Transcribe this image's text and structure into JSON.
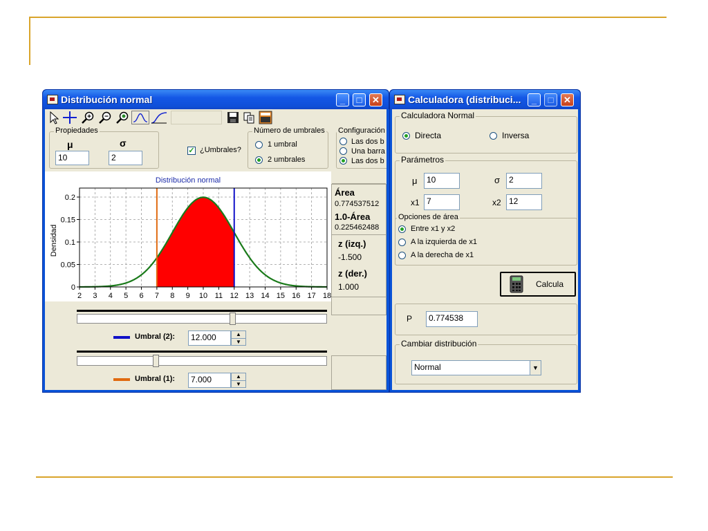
{
  "main_window": {
    "title": "Distribución normal",
    "properties": {
      "group_title": "Propiedades",
      "mu_label": "μ",
      "sigma_label": "σ",
      "mu_value": "10",
      "sigma_value": "2"
    },
    "thresholds_checkbox_label": "¿Umbrales?",
    "num_thresholds": {
      "group_title": "Número de umbrales",
      "option1": "1 umbral",
      "option2": "2 umbrales"
    },
    "configuration": {
      "group_title": "Configuración",
      "option1": "Las dos b",
      "option2": "Una barra",
      "option3": "Las dos b"
    },
    "info": {
      "area_label": "Área",
      "area_value": "0.774537512",
      "complement_label": "1.0-Área",
      "complement_value": "0.225462488",
      "z_left_label": "z (izq.)",
      "z_left_value": "-1.500",
      "z_right_label": "z (der.)",
      "z_right_value": "1.000"
    },
    "threshold2": {
      "label": "Umbral (2):",
      "value": "12.000",
      "color": "#1010c8"
    },
    "threshold1": {
      "label": "Umbral (1):",
      "value": "7.000",
      "color": "#e06a10"
    }
  },
  "chart_data": {
    "type": "area",
    "title": "Distribución normal",
    "ylabel": "Densidad",
    "xlabel": "",
    "mu": 10,
    "sigma": 2,
    "xlim": [
      2,
      18
    ],
    "ylim": [
      0,
      0.22
    ],
    "x_ticks": [
      2,
      3,
      4,
      5,
      6,
      7,
      8,
      9,
      10,
      11,
      12,
      13,
      14,
      15,
      16,
      17,
      18
    ],
    "y_ticks": [
      0,
      0.05,
      0.1,
      0.15,
      0.2
    ],
    "y_tick_labels": [
      "0",
      "0.05",
      "0.1",
      "0.15",
      "0.2"
    ],
    "shaded_interval": [
      7,
      12
    ],
    "threshold_lines": [
      {
        "x": 7,
        "color": "#e06a10"
      },
      {
        "x": 12,
        "color": "#1010c8"
      }
    ],
    "curve_color": "#1a7a1a",
    "fill_color": "#ff0000",
    "grid": true
  },
  "calc_window": {
    "title": "Calculadora (distribuci...",
    "calc_group_title": "Calculadora Normal",
    "direct_label": "Directa",
    "inverse_label": "Inversa",
    "params_group_title": "Parámetros",
    "mu_label": "μ",
    "mu_value": "10",
    "sigma_label": "σ",
    "sigma_value": "2",
    "x1_label": "x1",
    "x1_value": "7",
    "x2_label": "x2",
    "x2_value": "12",
    "area_options_title": "Opciones de área",
    "area_option1": "Entre x1 y x2",
    "area_option2": "A la izquierda de x1",
    "area_option3": "A la derecha de x1",
    "calc_button_label": "Calcula",
    "p_label": "P",
    "p_value": "0.774538",
    "change_group_title": "Cambiar distribución",
    "distribution_selected": "Normal"
  }
}
